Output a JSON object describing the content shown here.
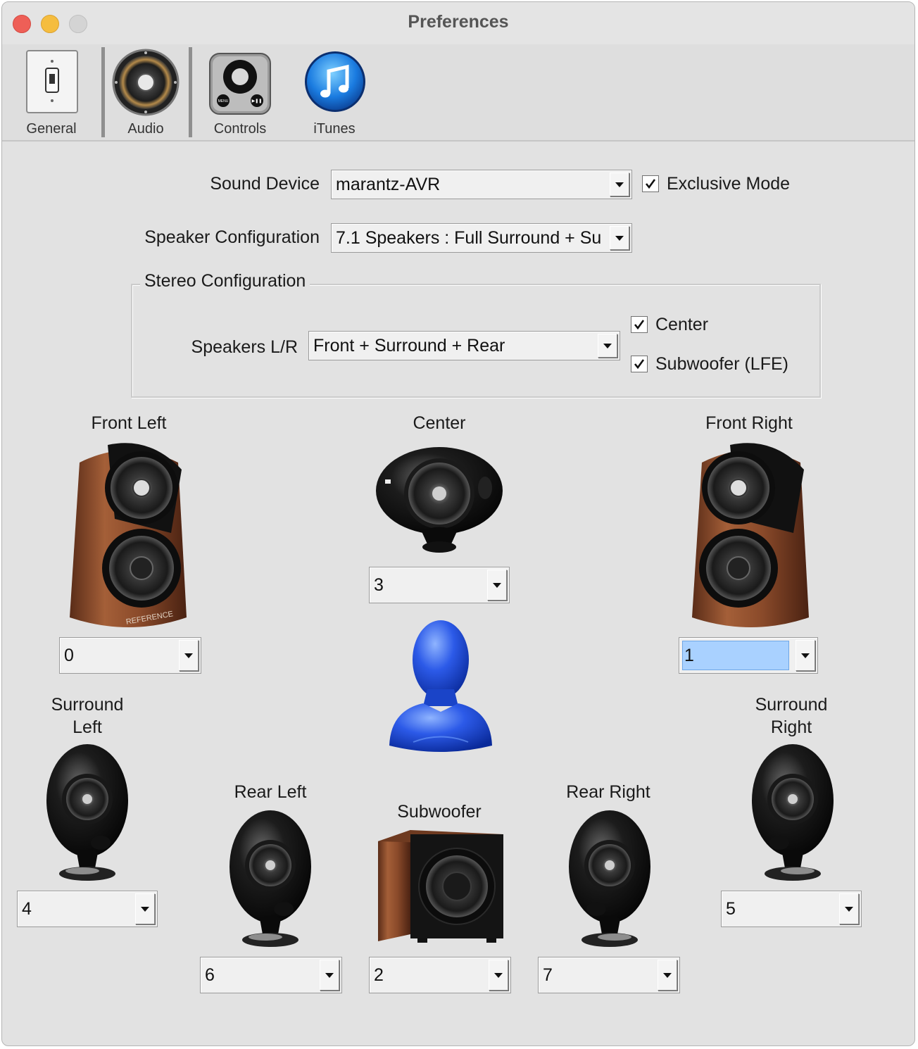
{
  "window": {
    "title": "Preferences"
  },
  "toolbar": {
    "items": [
      {
        "label": "General",
        "icon": "switch-icon"
      },
      {
        "label": "Audio",
        "icon": "speaker-icon",
        "selected": true
      },
      {
        "label": "Controls",
        "icon": "remote-icon"
      },
      {
        "label": "iTunes",
        "icon": "itunes-icon"
      }
    ]
  },
  "audio": {
    "sound_device_label": "Sound Device",
    "sound_device_value": "marantz-AVR",
    "exclusive_mode_label": "Exclusive Mode",
    "exclusive_mode_checked": true,
    "speaker_config_label": "Speaker Configuration",
    "speaker_config_value": "7.1 Speakers : Full Surround + Su",
    "stereo_group_title": "Stereo Configuration",
    "speakers_lr_label": "Speakers L/R",
    "speakers_lr_value": "Front + Surround + Rear",
    "center_label": "Center",
    "center_checked": true,
    "subwoofer_lfe_label": "Subwoofer (LFE)",
    "subwoofer_lfe_checked": true
  },
  "speakers": {
    "front_left": {
      "label": "Front Left",
      "channel": "0"
    },
    "center": {
      "label": "Center",
      "channel": "3"
    },
    "front_right": {
      "label": "Front Right",
      "channel": "1"
    },
    "surround_left": {
      "label_line1": "Surround",
      "label_line2": "Left",
      "channel": "4"
    },
    "surround_right": {
      "label_line1": "Surround",
      "label_line2": "Right",
      "channel": "5"
    },
    "rear_left": {
      "label": "Rear Left",
      "channel": "6"
    },
    "subwoofer": {
      "label": "Subwoofer",
      "channel": "2"
    },
    "rear_right": {
      "label": "Rear Right",
      "channel": "7"
    }
  },
  "colors": {
    "close": "#ee5f57",
    "minimize": "#f5bd3f",
    "maximize": "#d4d4d4",
    "wood": "#8a4a2a",
    "listener": "#1f4fd6",
    "selection": "#a9d1ff"
  }
}
